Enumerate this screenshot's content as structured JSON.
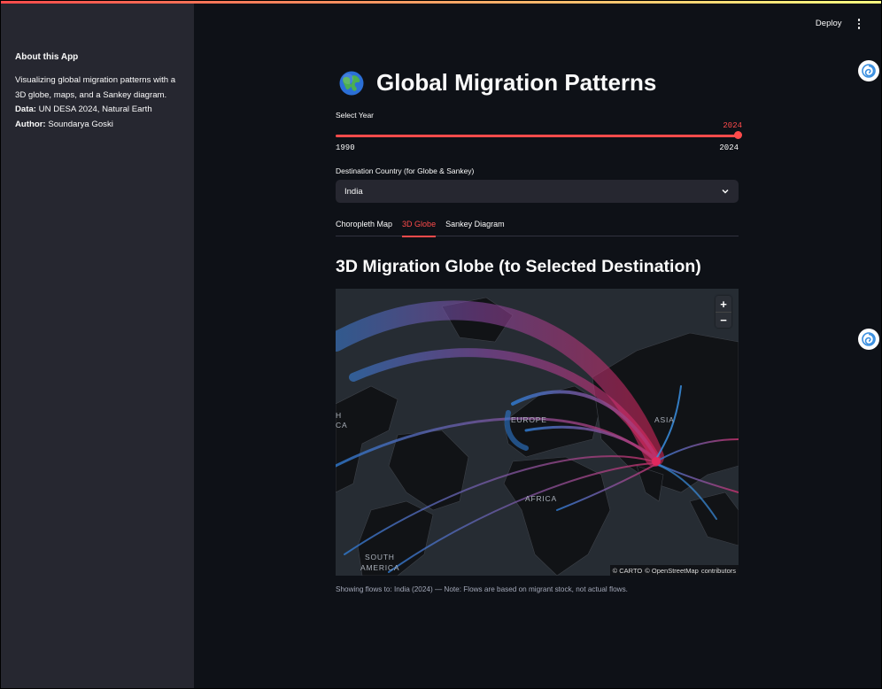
{
  "sidebar": {
    "title": "About this App",
    "description": "Visualizing global migration patterns with a 3D globe, maps, and a Sankey diagram.",
    "data_label": "Data:",
    "data_value": "UN DESA 2024, Natural Earth",
    "author_label": "Author:",
    "author_value": "Soundarya Goski"
  },
  "header": {
    "deploy_label": "Deploy",
    "menu_icon": "kebab-menu-icon"
  },
  "page": {
    "title": "Global Migration Patterns",
    "title_icon": "globe-emoji-icon"
  },
  "year_slider": {
    "label": "Select Year",
    "min": "1990",
    "max": "2024",
    "value": "2024"
  },
  "destination": {
    "label": "Destination Country (for Globe & Sankey)",
    "value": "India"
  },
  "tabs": [
    {
      "label": "Choropleth Map",
      "active": false
    },
    {
      "label": "3D Globe",
      "active": true
    },
    {
      "label": "Sankey Diagram",
      "active": false
    }
  ],
  "globe": {
    "heading": "3D Migration Globe (to Selected Destination)",
    "zoom_in": "+",
    "zoom_out": "−",
    "regions": [
      "EUROPE",
      "ASIA",
      "AFRICA",
      "SOUTH",
      "AMERICA",
      "H",
      "CA"
    ],
    "attribution": [
      "© CARTO",
      "© OpenStreetMap",
      "contributors"
    ]
  },
  "caption": "Showing flows to: India (2024) — Note: Flows are based on migrant stock, not actual flows.",
  "colors": {
    "accent": "#ff4b4b",
    "background": "#0e1117",
    "sidebar": "#262730"
  }
}
